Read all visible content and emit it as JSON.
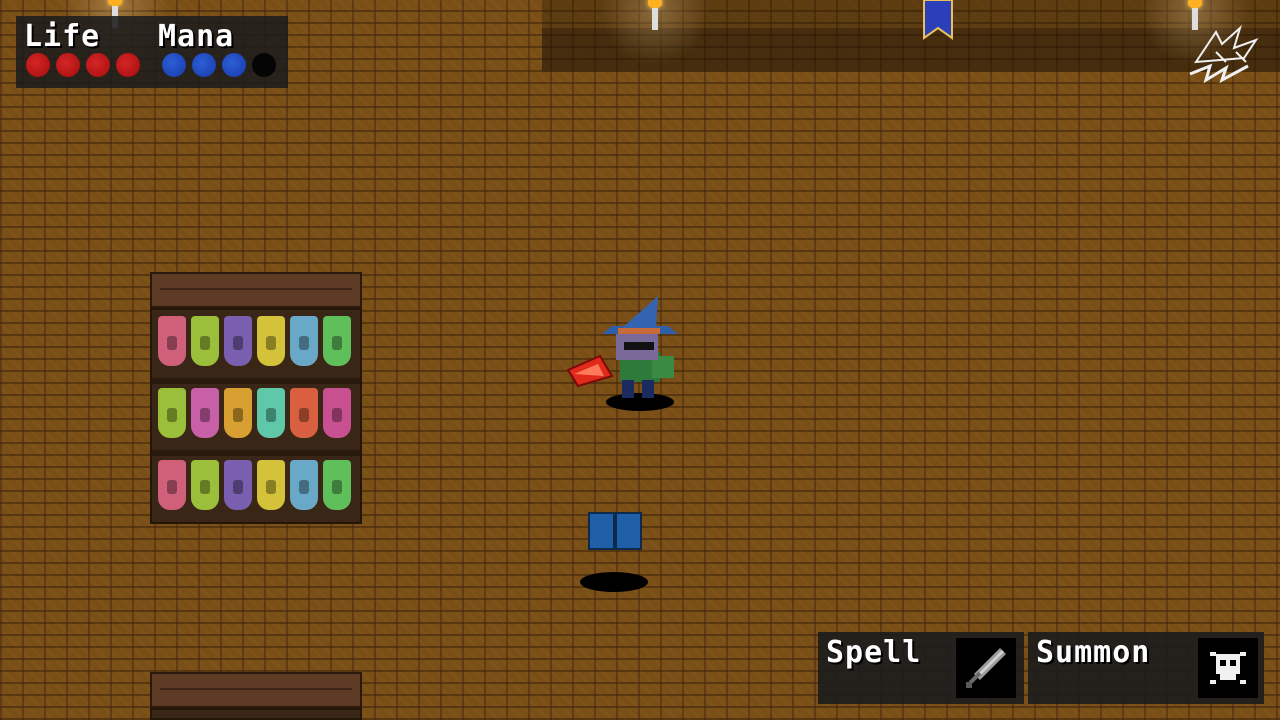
{
  "hud": {
    "life_label": "Life",
    "mana_label": "Mana",
    "life": {
      "current": 4,
      "max": 4
    },
    "mana": {
      "current": 3,
      "max": 4
    }
  },
  "actions": {
    "spell_label": "Spell",
    "spell_icon": "sword-icon",
    "summon_label": "Summon",
    "summon_icon": "skull-icon"
  },
  "colors": {
    "life": "#c21b1b",
    "mana": "#1f48c4",
    "empty_orb": "#050505",
    "wizard_hat": "#2f5fa8",
    "book": "#1e5fa8"
  },
  "potion_colors": [
    [
      "#d0607a",
      "#9bbf3a",
      "#7a5fb0",
      "#d4c23a",
      "#6aa8c8",
      "#5fbf5a"
    ],
    [
      "#9bbf3a",
      "#c860a8",
      "#d8a030",
      "#5fc8a8",
      "#d86040",
      "#c85090"
    ],
    [
      "#d0607a",
      "#9bbf3a",
      "#7a5fb0",
      "#d4c23a",
      "#6aa8c8",
      "#5fbf5a"
    ]
  ]
}
